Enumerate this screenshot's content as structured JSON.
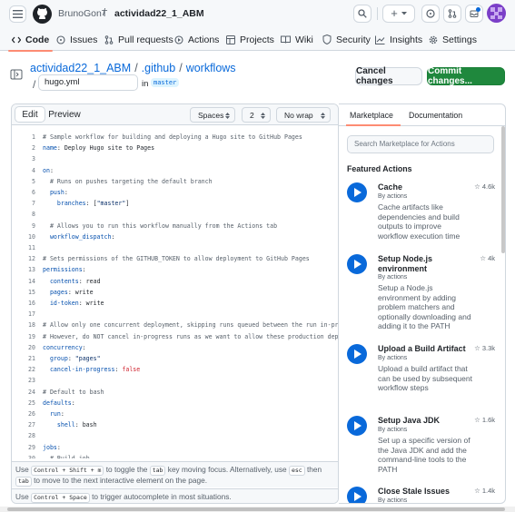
{
  "header": {
    "owner": "BrunoGonT",
    "separator": "/",
    "repo": "actividad22_1_ABM"
  },
  "tabs": [
    {
      "label": "Code",
      "icon": "code-icon"
    },
    {
      "label": "Issues",
      "icon": "issue-icon"
    },
    {
      "label": "Pull requests",
      "icon": "pull-request-icon"
    },
    {
      "label": "Actions",
      "icon": "play-icon"
    },
    {
      "label": "Projects",
      "icon": "table-icon"
    },
    {
      "label": "Wiki",
      "icon": "book-icon"
    },
    {
      "label": "Security",
      "icon": "shield-icon"
    },
    {
      "label": "Insights",
      "icon": "graph-icon"
    },
    {
      "label": "Settings",
      "icon": "gear-icon"
    }
  ],
  "file": {
    "breadcrumb_repo": "actividad22_1_ABM",
    "sep1": "/",
    "breadcrumb_dir1": ".github",
    "sep2": "/",
    "breadcrumb_dir2": "workflows",
    "slash": "/",
    "filename": "hugo.yml",
    "in_label": "in",
    "branch": "master",
    "cancel_label": "Cancel changes",
    "commit_label": "Commit changes..."
  },
  "editor": {
    "edit_tab": "Edit",
    "preview_tab": "Preview",
    "indent_mode": "Spaces",
    "indent_size": "2",
    "wrap_mode": "No wrap",
    "lines": [
      {
        "n": "1",
        "text": "# Sample workflow for building and deploying a Hugo site to GitHub Pages"
      },
      {
        "n": "2",
        "text": "name: Deploy Hugo site to Pages"
      },
      {
        "n": "3",
        "text": ""
      },
      {
        "n": "4",
        "text": "on:"
      },
      {
        "n": "5",
        "text": "  # Runs on pushes targeting the default branch"
      },
      {
        "n": "6",
        "text": "  push:"
      },
      {
        "n": "7",
        "text": "    branches: [\"master\"]"
      },
      {
        "n": "8",
        "text": ""
      },
      {
        "n": "9",
        "text": "  # Allows you to run this workflow manually from the Actions tab"
      },
      {
        "n": "10",
        "text": "  workflow_dispatch:"
      },
      {
        "n": "11",
        "text": ""
      },
      {
        "n": "12",
        "text": "# Sets permissions of the GITHUB_TOKEN to allow deployment to GitHub Pages"
      },
      {
        "n": "13",
        "text": "permissions:"
      },
      {
        "n": "14",
        "text": "  contents: read"
      },
      {
        "n": "15",
        "text": "  pages: write"
      },
      {
        "n": "16",
        "text": "  id-token: write"
      },
      {
        "n": "17",
        "text": ""
      },
      {
        "n": "18",
        "text": "# Allow only one concurrent deployment, skipping runs queued between the run in-pr"
      },
      {
        "n": "19",
        "text": "# However, do NOT cancel in-progress runs as we want to allow these production dep"
      },
      {
        "n": "20",
        "text": "concurrency:"
      },
      {
        "n": "21",
        "text": "  group: \"pages\""
      },
      {
        "n": "22",
        "text": "  cancel-in-progress: false"
      },
      {
        "n": "23",
        "text": ""
      },
      {
        "n": "24",
        "text": "# Default to bash"
      },
      {
        "n": "25",
        "text": "defaults:"
      },
      {
        "n": "26",
        "text": "  run:"
      },
      {
        "n": "27",
        "text": "    shell: bash"
      },
      {
        "n": "28",
        "text": ""
      },
      {
        "n": "29",
        "text": "jobs:"
      },
      {
        "n": "30",
        "text": "  # Build job"
      }
    ],
    "hint1_a": "Use",
    "hint1_k1": "Control + Shift + m",
    "hint1_b": "to toggle the",
    "hint1_k2": "tab",
    "hint1_c": "key moving focus. Alternatively, use",
    "hint1_k3": "esc",
    "hint1_d": "then",
    "hint1_k4": "tab",
    "hint1_e": "to move",
    "hint1_f": "to the next interactive element on the page.",
    "hint2_a": "Use",
    "hint2_k1": "Control + Space",
    "hint2_b": "to trigger autocomplete in most situations."
  },
  "marketplace": {
    "tab_marketplace": "Marketplace",
    "tab_docs": "Documentation",
    "search_placeholder": "Search Marketplace for Actions",
    "featured_heading": "Featured Actions",
    "actions": [
      {
        "title": "Cache",
        "by": "By actions",
        "stars": "4.6k",
        "desc": "Cache artifacts like dependencies and build outputs to improve workflow execution time"
      },
      {
        "title": "Setup Node.js environment",
        "by": "By actions",
        "stars": "4k",
        "desc": "Setup a Node.js environment by adding problem matchers and optionally downloading and adding it to the PATH"
      },
      {
        "title": "Upload a Build Artifact",
        "by": "By actions",
        "stars": "3.3k",
        "desc": "Upload a build artifact that can be used by subsequent workflow steps"
      },
      {
        "title": "Setup Java JDK",
        "by": "By actions",
        "stars": "1.6k",
        "desc": "Set up a specific version of the Java JDK and add the command-line tools to the PATH"
      },
      {
        "title": "Close Stale Issues",
        "by": "By actions",
        "stars": "1.4k",
        "desc": ""
      }
    ]
  },
  "colors": {
    "accent_blue": "#0969da",
    "commit_green": "#1f883d",
    "tab_underline": "#fd8c73"
  }
}
